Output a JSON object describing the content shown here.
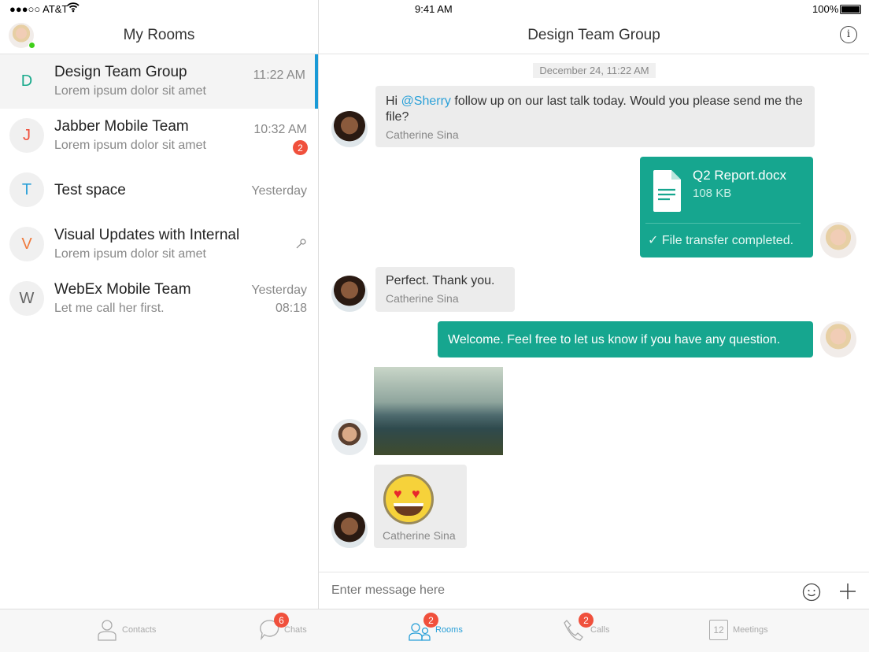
{
  "status_bar": {
    "carrier": "●●●○○ AT&T",
    "time": "9:41 AM",
    "battery": "100%"
  },
  "left": {
    "title": "My Rooms",
    "rooms": [
      {
        "initial": "D",
        "initial_color": "#1aaa8c",
        "name": "Design Team Group",
        "preview": "Lorem ipsum dolor sit amet",
        "time": "11:22 AM",
        "selected": true
      },
      {
        "initial": "J",
        "initial_color": "#f0503c",
        "name": "Jabber Mobile Team",
        "preview": "Lorem ipsum dolor sit amet",
        "time": "10:32 AM",
        "badge": "2"
      },
      {
        "initial": "T",
        "initial_color": "#2aa0d8",
        "name": "Test space",
        "preview": "",
        "time": "Yesterday"
      },
      {
        "initial": "V",
        "initial_color": "#f07a3c",
        "name": "Visual Updates with Internal",
        "preview": "Lorem ipsum dolor sit amet",
        "time": "",
        "icon": "pin-icon"
      },
      {
        "initial": "W",
        "initial_color": "#666666",
        "name": "WebEx Mobile Team",
        "preview": "Let me call her first.",
        "time": "Yesterday",
        "time2": "08:18"
      }
    ]
  },
  "chat": {
    "title": "Design Team Group",
    "date": "December 24, 11:22 AM",
    "msg1": {
      "pre": "Hi ",
      "mention": "@Sherry",
      "post": " follow up on our last talk today. Would you please send me the file?",
      "sender": "Catherine Sina"
    },
    "file": {
      "name": "Q2 Report.docx",
      "size": "108 KB",
      "status": "✓ File transfer completed."
    },
    "msg2": {
      "text": "Perfect. Thank you.",
      "sender": "Catherine Sina"
    },
    "msg3": {
      "text": "Welcome. Feel free to let us know if you have any question."
    },
    "msg5": {
      "sender": "Catherine Sina"
    },
    "input_placeholder": "Enter message here"
  },
  "tabs": [
    {
      "label": "Contacts"
    },
    {
      "label": "Chats",
      "badge": "6"
    },
    {
      "label": "Rooms",
      "badge": "2",
      "active": true
    },
    {
      "label": "Calls",
      "badge": "2"
    },
    {
      "label": "Meetings",
      "day": "12"
    }
  ],
  "colors": {
    "accent": "#16a68f",
    "active_tab": "#2aa0d8",
    "badge": "#f0503c"
  }
}
